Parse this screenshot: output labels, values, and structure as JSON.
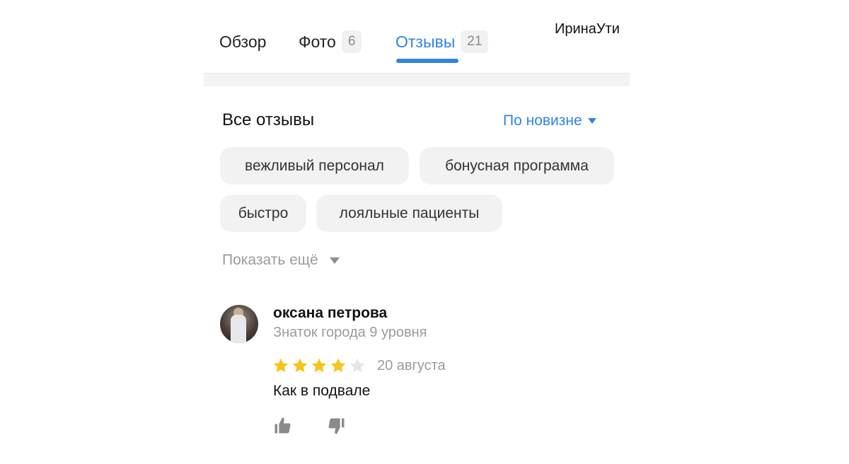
{
  "tabs": {
    "overview": "Обзор",
    "photo": "Фото",
    "photo_count": "6",
    "reviews": "Отзывы",
    "reviews_count": "21",
    "active_color": "#2f84e4"
  },
  "user": {
    "name": "ИринаУти"
  },
  "reviews_section": {
    "title": "Все отзывы",
    "sort_label": "По новизне",
    "tags": [
      "вежливый персонал",
      "бонусная программа",
      "быстро",
      "лояльные пациенты"
    ],
    "show_more": "Показать ещё"
  },
  "review": {
    "author": "оксана петрова",
    "level": "Знаток города 9 уровня",
    "rating": 4,
    "rating_max": 5,
    "date": "20 августа",
    "text": "Как в подвале",
    "star_color": "#f7c418",
    "star_empty_color": "#e6e6e6",
    "icons": {
      "like": "thumbs-up-icon",
      "dislike": "thumbs-down-icon"
    }
  }
}
